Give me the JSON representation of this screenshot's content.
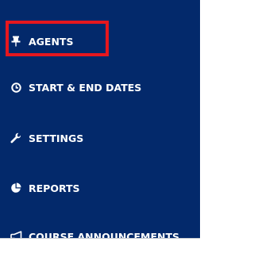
{
  "menu": {
    "items": [
      {
        "label": "AGENTS",
        "icon": "pin-icon"
      },
      {
        "label": "START & END DATES",
        "icon": "clock-icon"
      },
      {
        "label": "SETTINGS",
        "icon": "wrench-icon"
      },
      {
        "label": "REPORTS",
        "icon": "pie-chart-icon"
      },
      {
        "label": "COURSE ANNOUNCEMENTS",
        "icon": "megaphone-icon"
      }
    ],
    "highlighted_item": "AGENTS"
  },
  "colors": {
    "panel_background": "#03296b",
    "text": "#ffffff",
    "highlight_border": "#e6171e"
  }
}
